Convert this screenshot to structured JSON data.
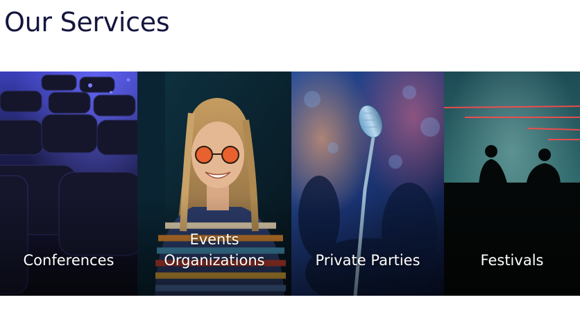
{
  "section": {
    "title": "Our Services"
  },
  "services": [
    {
      "id": "conferences",
      "lines": [
        "Conferences"
      ],
      "image": "conference-hall-chairs"
    },
    {
      "id": "events-organizations",
      "lines": [
        "Events",
        "Organizations"
      ],
      "image": "smiling-woman-sunglasses"
    },
    {
      "id": "private-parties",
      "lines": [
        "Private Parties"
      ],
      "image": "vintage-microphone"
    },
    {
      "id": "festivals",
      "lines": [
        "Festivals"
      ],
      "image": "dj-silhouettes-lasers"
    }
  ]
}
